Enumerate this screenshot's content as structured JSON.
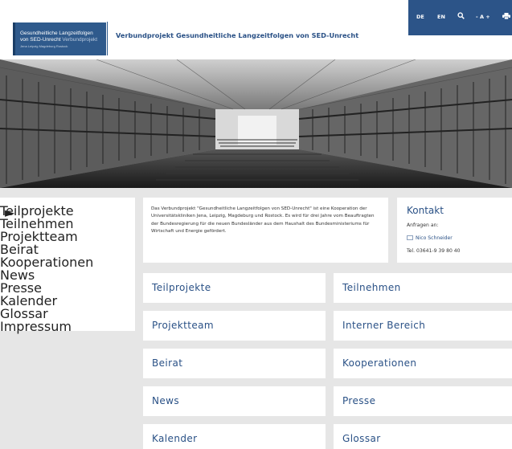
{
  "header": {
    "logo_line1": "Gesundheitliche Langzeitfolgen",
    "logo_line2_a": "von SED-Unrecht",
    "logo_line2_b": "Verbundprojekt",
    "logo_line3": "Jena Leipzig Magdeburg Rostock",
    "site_title": "Verbundprojekt Gesundheitliche Langzeitfolgen von SED-Unrecht"
  },
  "utility": {
    "lang_de": "DE",
    "lang_en": "EN",
    "font_size": "- A +"
  },
  "sidebar": {
    "items": [
      "Teilprojekte",
      "Teilnehmen",
      "Projektteam",
      "Beirat",
      "Kooperationen",
      "News",
      "Presse",
      "Kalender",
      "Glossar",
      "Impressum"
    ]
  },
  "intro": {
    "text": "Das Verbundprojekt \"Gesundheitliche Langzeitfolgen von SED-Unrecht\" ist eine Kooperation der Universitätskliniken Jena, Leipzig, Magdeburg und Rostock. Es wird für drei Jahre vom Beauftragten der Bundesregierung für die neuen Bundesländer aus dem Haushalt des Bundesministeriums für Wirtschaft und Energie gefördert."
  },
  "contact": {
    "title": "Kontakt",
    "label": "Anfragen an:",
    "name": "Nico Schneider",
    "phone": "Tel. 03641-9 39 80 40"
  },
  "tiles": [
    "Teilprojekte",
    "Teilnehmen",
    "Projektteam",
    "Interner Bereich",
    "Beirat",
    "Kooperationen",
    "News",
    "Presse",
    "Kalender",
    "Glossar"
  ],
  "colors": {
    "brand_blue": "#2a5186",
    "utility_bar": "#2c5488",
    "page_bg": "#e6e6e6"
  },
  "icons": {
    "search": "search-icon",
    "print": "print-icon",
    "mail": "mail-icon",
    "active_item": "triangle-right-icon"
  }
}
